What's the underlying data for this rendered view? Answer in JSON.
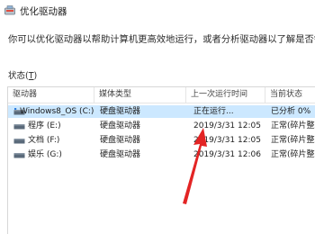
{
  "window": {
    "title": "优化驱动器"
  },
  "description": "你可以优化驱动器以帮助计算机更高效地运行，或者分析驱动器以了解是否需要对其进行优化",
  "status": {
    "label": "状态",
    "accel": "T"
  },
  "table": {
    "columns": [
      "驱动器",
      "媒体类型",
      "上一次运行时间",
      "当前状态"
    ],
    "rows": [
      {
        "drive": "Windows8_OS (C:)",
        "media": "硬盘驱动器",
        "last_run": "正在运行...",
        "status": "已分析 0%",
        "selected": true
      },
      {
        "drive": "程序 (E:)",
        "media": "硬盘驱动器",
        "last_run": "2019/3/31 12:05",
        "status": "正常(碎片整理",
        "selected": false
      },
      {
        "drive": "文档 (F:)",
        "media": "硬盘驱动器",
        "last_run": "2019/3/31 12:05",
        "status": "正常(碎片整理",
        "selected": false
      },
      {
        "drive": "娱乐 (G:)",
        "media": "硬盘驱动器",
        "last_run": "2019/3/31 12:06",
        "status": "正常(碎片整理",
        "selected": false
      }
    ]
  },
  "colors": {
    "selection": "#cce8ff",
    "arrow": "#e32424",
    "drive_icon": "#5a6a7a"
  }
}
